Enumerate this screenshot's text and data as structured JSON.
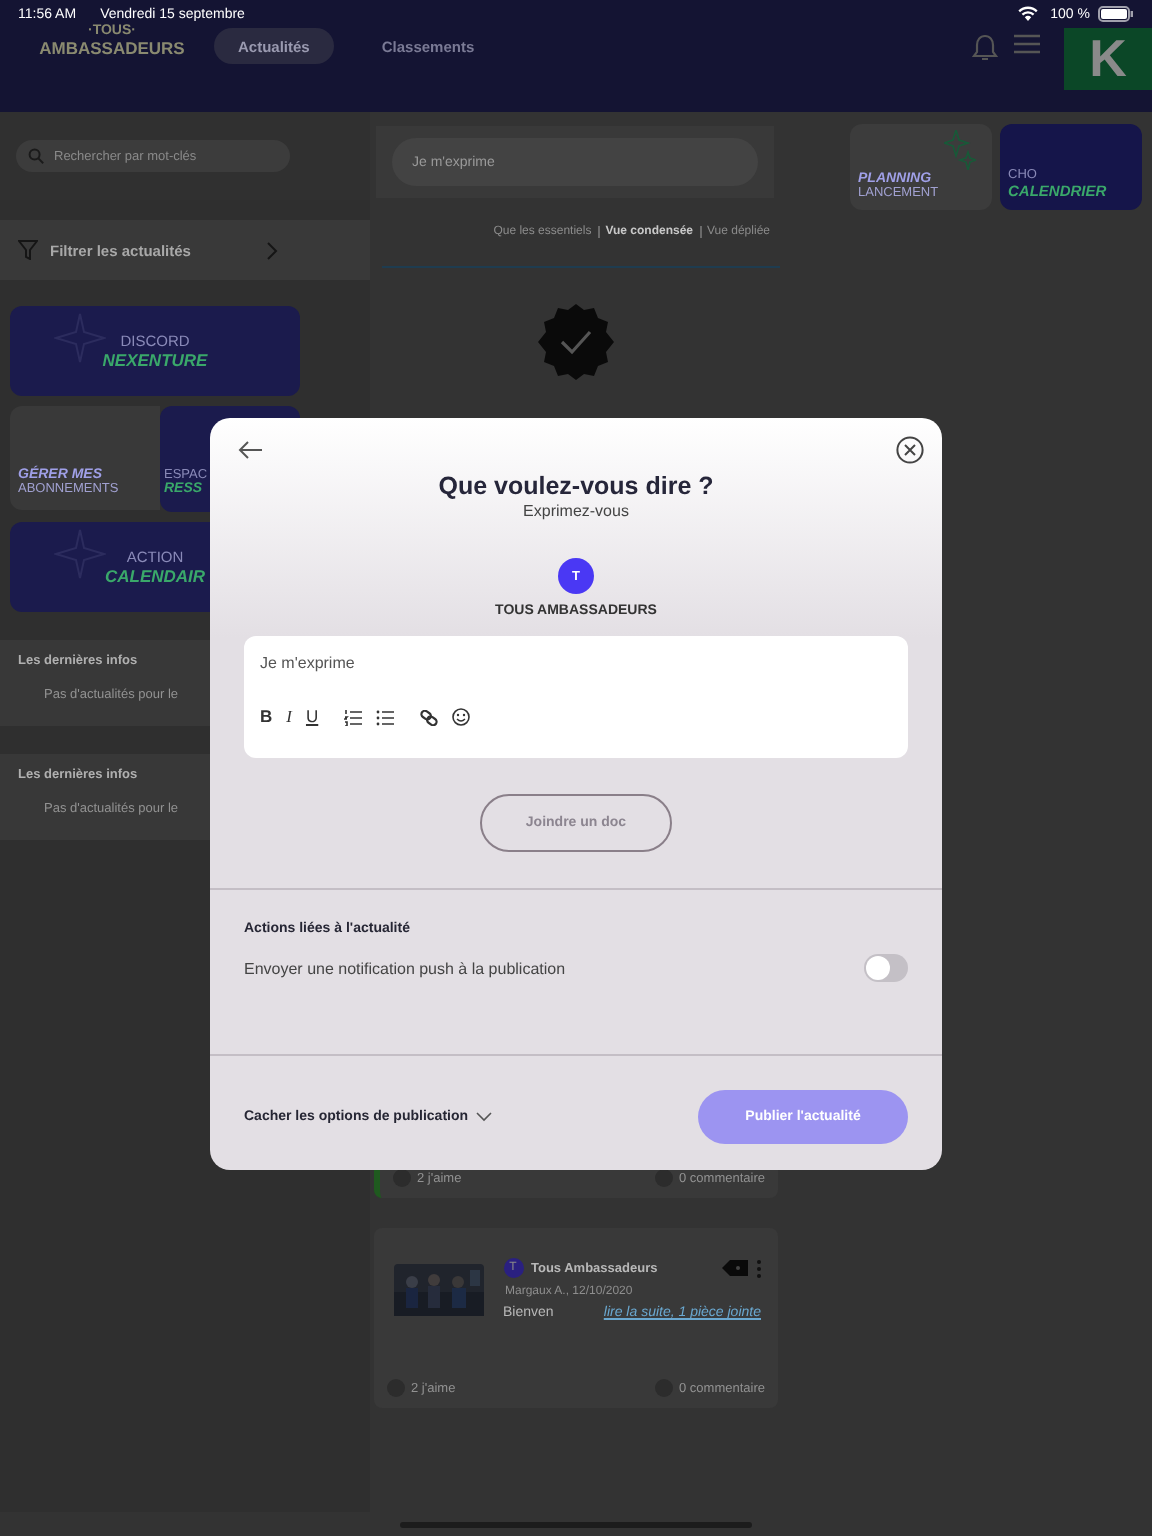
{
  "status_bar": {
    "time": "11:56 AM",
    "date": "Vendredi 15 septembre",
    "battery": "100 %"
  },
  "header": {
    "logo_top": "·TOUS·",
    "logo_main": "AMBASSADEURS",
    "tabs": [
      {
        "label": "Actualités",
        "selected": true
      },
      {
        "label": "Classements",
        "selected": false
      }
    ],
    "avatar_letter": "K"
  },
  "sidebar": {
    "search_placeholder": "Rechercher par mot-clés",
    "filter_label": "Filtrer les actualités",
    "tiles": [
      {
        "kind": "wide",
        "line1": "DISCORD",
        "line2": "NEXENTURE"
      },
      {
        "kind": "light",
        "line1": "GÉRER MES",
        "line2": "ABONNEMENTS"
      },
      {
        "kind": "dark",
        "line1": "ESPAC",
        "line2": "RESS"
      },
      {
        "kind": "wide",
        "line1": "ACTION",
        "line2": "CALENDAIR"
      }
    ],
    "sections": [
      {
        "title": "Les dernières infos",
        "empty_text": "Pas d'actualités pour le"
      },
      {
        "title": "Les dernières infos",
        "empty_text": "Pas d'actualités pour le"
      }
    ]
  },
  "feed": {
    "composer_placeholder": "Je m'exprime",
    "views": [
      {
        "label": "Que les essentiels",
        "selected": false
      },
      {
        "label": "Vue condensée",
        "selected": true
      },
      {
        "label": "Vue dépliée",
        "selected": false
      }
    ],
    "posts": [
      {
        "kind": "partial",
        "color": "#1f5a1f",
        "likes": "2 j'aime",
        "comments": "0 commentaire"
      },
      {
        "kind": "full",
        "author_initial": "T",
        "author": "Tous Ambassadeurs",
        "meta": "Margaux A., 12/10/2020",
        "excerpt": "Bienven",
        "link": "lire la suite, 1 pièce jointe",
        "likes": "2 j'aime",
        "comments": "0 commentaire"
      }
    ]
  },
  "shortcuts": [
    {
      "kind": "light",
      "line1": "PLANNING",
      "line2": "LANCEMENT"
    },
    {
      "kind": "dark",
      "line1": "CHO",
      "line2": "CALENDRIER"
    }
  ],
  "modal": {
    "title": "Que voulez-vous dire ?",
    "subtitle": "Exprimez-vous",
    "audience_initial": "T",
    "audience": "TOUS AMBASSADEURS",
    "editor_placeholder": "Je m'exprime",
    "tools": [
      {
        "kind": "bold",
        "label": "B"
      },
      {
        "kind": "italic",
        "label": "I"
      },
      {
        "kind": "underline",
        "label": "U"
      },
      {
        "kind": "ordered-list"
      },
      {
        "kind": "bullet-list"
      },
      {
        "kind": "link"
      },
      {
        "kind": "emoji"
      }
    ],
    "attach_button": "Joindre un doc",
    "actions_title": "Actions liées à l'actualité",
    "push_label": "Envoyer une notification push à la publication",
    "push_on": false,
    "options_toggle": "Cacher les options de publication",
    "publish_button": "Publier l'actualité"
  }
}
